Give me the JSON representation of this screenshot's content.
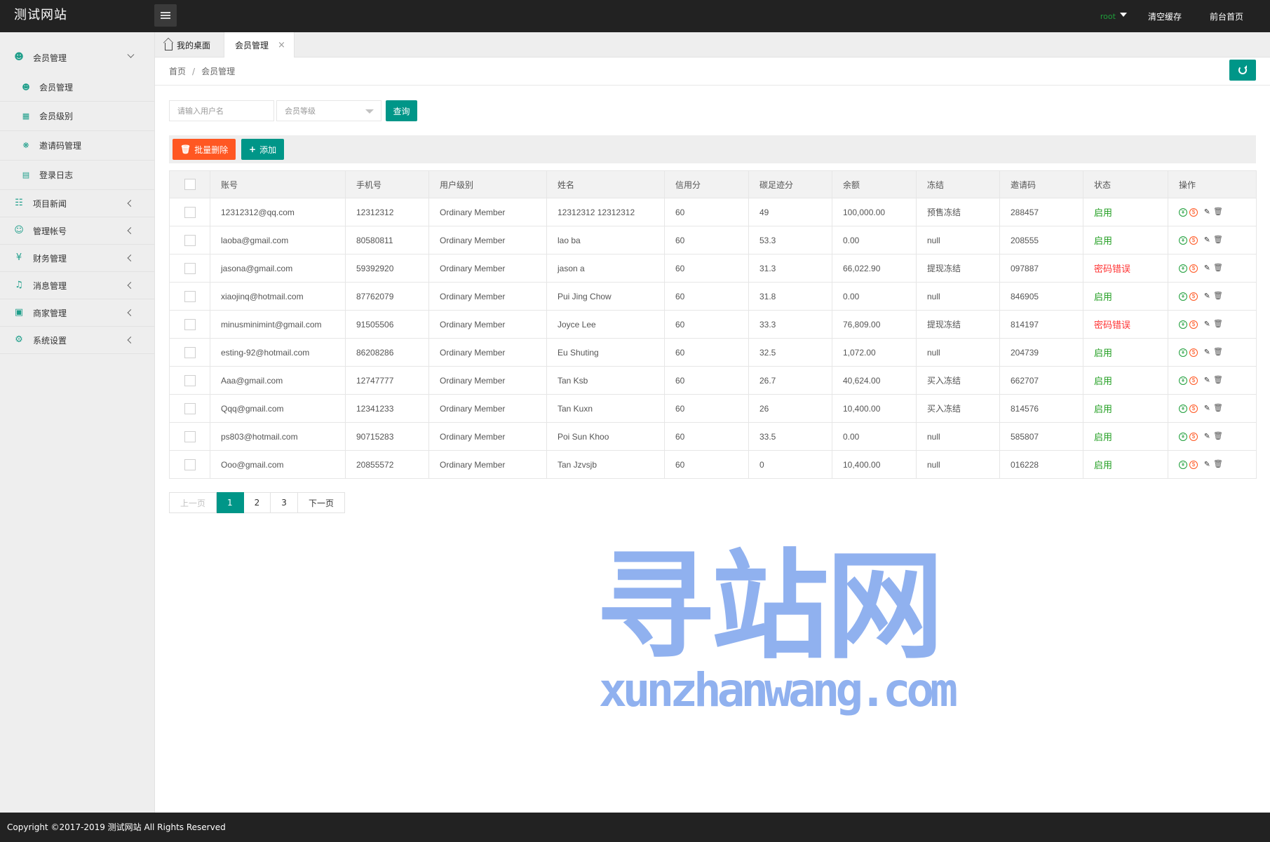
{
  "header": {
    "site_title": "测试网站",
    "user": "root",
    "clear_cache": "清空缓存",
    "front_home": "前台首页"
  },
  "sidebar": {
    "groups": [
      {
        "label": "会员管理",
        "icon": "user-icon",
        "expanded": true,
        "items": [
          {
            "label": "会员管理",
            "icon": "user-icon"
          },
          {
            "label": "会员级别",
            "icon": "level-icon"
          },
          {
            "label": "邀请码管理",
            "icon": "share-icon"
          },
          {
            "label": "登录日志",
            "icon": "calendar-icon"
          }
        ]
      },
      {
        "label": "项目新闻",
        "icon": "book-icon"
      },
      {
        "label": "管理帐号",
        "icon": "users-icon"
      },
      {
        "label": "财务管理",
        "icon": "yen-icon"
      },
      {
        "label": "消息管理",
        "icon": "speaker-icon"
      },
      {
        "label": "商家管理",
        "icon": "image-icon"
      },
      {
        "label": "系统设置",
        "icon": "gear-icon"
      }
    ]
  },
  "tabs": {
    "home": "我的桌面",
    "active": "会员管理",
    "close": "×"
  },
  "breadcrumb": {
    "home": "首页",
    "sep": "/",
    "current": "会员管理"
  },
  "search": {
    "username_placeholder": "请输入用户名",
    "level_placeholder": "会员等级",
    "query_label": "查询"
  },
  "toolbar": {
    "batch_delete": "批量删除",
    "add": "添加"
  },
  "table": {
    "columns": [
      "账号",
      "手机号",
      "用户级别",
      "姓名",
      "信用分",
      "碳足迹分",
      "余额",
      "冻结",
      "邀请码",
      "状态",
      "操作"
    ],
    "rows": [
      {
        "account": "12312312@qq.com",
        "phone": "12312312",
        "level": "Ordinary Member",
        "name": "12312312 12312312",
        "credit": "60",
        "carbon": "49",
        "balance": "100,000.00",
        "frozen": "预售冻结",
        "invite": "288457",
        "status": "启用",
        "status_type": "ok"
      },
      {
        "account": "laoba@gmail.com",
        "phone": "80580811",
        "level": "Ordinary Member",
        "name": "lao ba",
        "credit": "60",
        "carbon": "53.3",
        "balance": "0.00",
        "frozen": "null",
        "invite": "208555",
        "status": "启用",
        "status_type": "ok"
      },
      {
        "account": "jasona@gmail.com",
        "phone": "59392920",
        "level": "Ordinary Member",
        "name": "jason a",
        "credit": "60",
        "carbon": "31.3",
        "balance": "66,022.90",
        "frozen": "提现冻结",
        "invite": "097887",
        "status": "密码错误",
        "status_type": "err"
      },
      {
        "account": "xiaojinq@hotmail.com",
        "phone": "87762079",
        "level": "Ordinary Member",
        "name": "Pui Jing Chow",
        "credit": "60",
        "carbon": "31.8",
        "balance": "0.00",
        "frozen": "null",
        "invite": "846905",
        "status": "启用",
        "status_type": "ok"
      },
      {
        "account": "minusminimint@gmail.com",
        "phone": "91505506",
        "level": "Ordinary Member",
        "name": "Joyce Lee",
        "credit": "60",
        "carbon": "33.3",
        "balance": "76,809.00",
        "frozen": "提现冻结",
        "invite": "814197",
        "status": "密码错误",
        "status_type": "err"
      },
      {
        "account": "esting-92@hotmail.com",
        "phone": "86208286",
        "level": "Ordinary Member",
        "name": "Eu Shuting",
        "credit": "60",
        "carbon": "32.5",
        "balance": "1,072.00",
        "frozen": "null",
        "invite": "204739",
        "status": "启用",
        "status_type": "ok"
      },
      {
        "account": "Aaa@gmail.com",
        "phone": "12747777",
        "level": "Ordinary Member",
        "name": "Tan Ksb",
        "credit": "60",
        "carbon": "26.7",
        "balance": "40,624.00",
        "frozen": "买入冻结",
        "invite": "662707",
        "status": "启用",
        "status_type": "ok"
      },
      {
        "account": "Qqq@gmail.com",
        "phone": "12341233",
        "level": "Ordinary Member",
        "name": "Tan Kuxn",
        "credit": "60",
        "carbon": "26",
        "balance": "10,400.00",
        "frozen": "买入冻结",
        "invite": "814576",
        "status": "启用",
        "status_type": "ok"
      },
      {
        "account": "ps803@hotmail.com",
        "phone": "90715283",
        "level": "Ordinary Member",
        "name": "Poi Sun Khoo",
        "credit": "60",
        "carbon": "33.5",
        "balance": "0.00",
        "frozen": "null",
        "invite": "585807",
        "status": "启用",
        "status_type": "ok"
      },
      {
        "account": "Ooo@gmail.com",
        "phone": "20855572",
        "level": "Ordinary Member",
        "name": "Tan Jzvsjb",
        "credit": "60",
        "carbon": "0",
        "balance": "10,400.00",
        "frozen": "null",
        "invite": "016228",
        "status": "启用",
        "status_type": "ok"
      }
    ]
  },
  "pagination": {
    "prev": "上一页",
    "pages": [
      "1",
      "2",
      "3"
    ],
    "current": "1",
    "next": "下一页"
  },
  "watermark": {
    "big": "寻站网",
    "small": "xunzhanwang.com"
  },
  "footer": {
    "copyright": "Copyright ©2017-2019 测试网站 All Rights Reserved"
  },
  "colors": {
    "header_bg": "#222222",
    "primary": "#009688",
    "danger": "#ff5722",
    "status_ok": "#1f9d1f",
    "status_err": "#ff3333"
  }
}
